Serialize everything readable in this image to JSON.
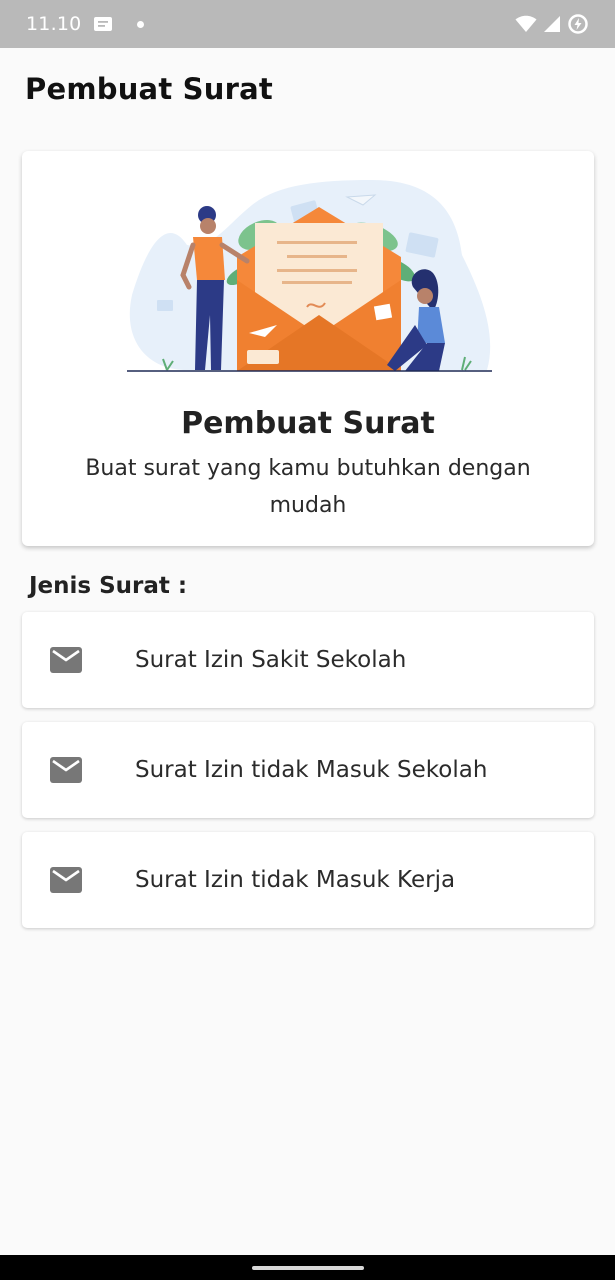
{
  "status_bar": {
    "time": "11.10",
    "icons": [
      "message-icon",
      "notification-dot-icon",
      "wifi-icon",
      "signal-icon",
      "battery-saver-icon"
    ]
  },
  "app_bar": {
    "title": "Pembuat Surat"
  },
  "hero": {
    "title": "Pembuat Surat",
    "subtitle": "Buat surat yang kamu butuhkan dengan mudah",
    "illustration_icon": "envelope-illustration"
  },
  "section": {
    "title": "Jenis Surat :"
  },
  "letter_types": [
    {
      "label": "Surat Izin Sakit Sekolah",
      "icon": "mail-icon"
    },
    {
      "label": "Surat Izin tidak Masuk Sekolah",
      "icon": "mail-icon"
    },
    {
      "label": "Surat Izin tidak Masuk Kerja",
      "icon": "mail-icon"
    }
  ],
  "colors": {
    "status_bar": "#b9b9b9",
    "background": "#fafafa",
    "card": "#ffffff",
    "accent_orange": "#f5883a",
    "navy": "#2c3a86",
    "icon_gray": "#777777"
  }
}
